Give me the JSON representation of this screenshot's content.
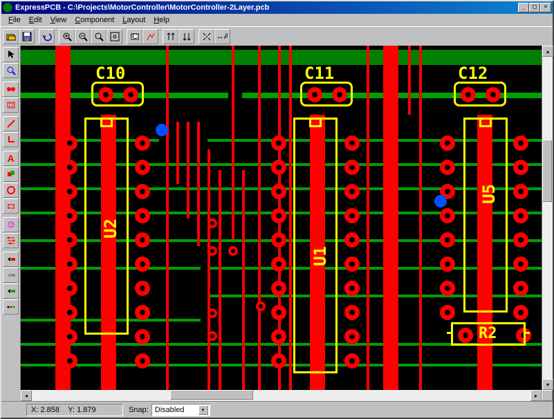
{
  "app_name": "ExpressPCB",
  "file_path": "C:\\Projects\\MotorController\\MotorController-2Layer.pcb",
  "titlebar_text": "ExpressPCB - C:\\Projects\\MotorController\\MotorController-2Layer.pcb",
  "menu": {
    "file": "File",
    "edit": "Edit",
    "view": "View",
    "component": "Component",
    "layout": "Layout",
    "help": "Help"
  },
  "toolbar_icons": {
    "open": "📂",
    "save": "💾",
    "undo": "↶",
    "redo": "↷",
    "zoom_in": "🔍+",
    "zoom_out": "🔍-",
    "zoom_fit": "🔍",
    "fit_window": "⛶",
    "info": "ⓘ",
    "arrows": "↕↕",
    "flip": "⇄",
    "center": "✦",
    "align": "⟷"
  },
  "side_tools": {
    "arrow": "↖",
    "zoom_area": "🔍",
    "pad": "●",
    "component": "▦",
    "trace": "╱",
    "corner": "⌐",
    "text": "A",
    "rect": "▭",
    "circle": "○",
    "arc": "⌒",
    "disconnect": "✕",
    "highlight": "?",
    "net": "≡",
    "layer_top": "◁",
    "layer_inner": "◁",
    "layer_bottom": "◁",
    "options": "⋮"
  },
  "statusbar": {
    "x_label": "X:",
    "x_value": "2.858",
    "y_label": "Y:",
    "y_value": "1.879",
    "snap_label": "Snap:",
    "snap_value": "Disabled"
  },
  "components": {
    "c10": "C10",
    "c11": "C11",
    "c12": "C12",
    "u1": "U1",
    "u2": "U2",
    "u5": "U5",
    "r2": "R2"
  },
  "colors": {
    "trace_top": "#ff0000",
    "trace_bottom": "#00a000",
    "silkscreen": "#ffff00",
    "via": "#0050ff",
    "background": "#000000"
  }
}
